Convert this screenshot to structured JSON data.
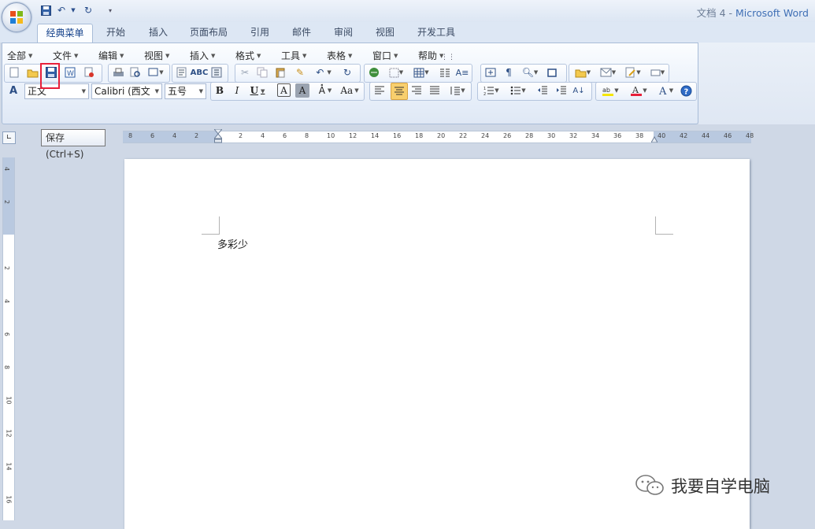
{
  "window": {
    "doc_name": "文档 4",
    "separator": " - ",
    "app_name": "Microsoft Word"
  },
  "tabs": [
    "经典菜单",
    "开始",
    "插入",
    "页面布局",
    "引用",
    "邮件",
    "审阅",
    "视图",
    "开发工具"
  ],
  "classic_menu": [
    "全部",
    "文件",
    "编辑",
    "视图",
    "插入",
    "格式",
    "工具",
    "表格",
    "窗口",
    "帮助"
  ],
  "formatting": {
    "style": "正文",
    "font": "Calibri (西文",
    "size": "五号"
  },
  "tooltip": "保存 (Ctrl+S)",
  "ruler": {
    "horizontal": [
      "8",
      "6",
      "4",
      "2",
      "2",
      "4",
      "6",
      "8",
      "10",
      "12",
      "14",
      "16",
      "18",
      "20",
      "22",
      "24",
      "26",
      "28",
      "30",
      "32",
      "34",
      "36",
      "38",
      "40",
      "42",
      "44",
      "46",
      "48"
    ],
    "vertical": [
      "4",
      "2",
      "2",
      "4",
      "6",
      "8",
      "10",
      "12",
      "14",
      "16"
    ]
  },
  "document": {
    "text": "多彩少"
  },
  "watermark": "我要自学电脑",
  "colors": {
    "highlight": "#e8203a",
    "accent": "#3f6fb5"
  }
}
